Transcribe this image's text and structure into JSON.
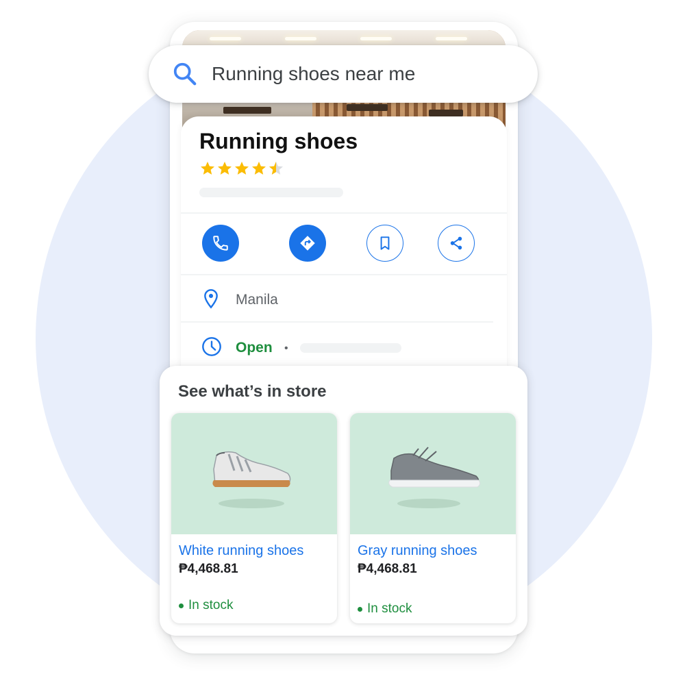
{
  "search": {
    "query": "Running shoes near me"
  },
  "place": {
    "title": "Running shoes",
    "rating": 4.5,
    "rating_max": 5,
    "location": "Manila",
    "status": "Open",
    "status_separator": "•"
  },
  "actions": [
    {
      "name": "call",
      "icon": "phone-icon"
    },
    {
      "name": "directions",
      "icon": "directions-icon"
    },
    {
      "name": "save",
      "icon": "bookmark-icon"
    },
    {
      "name": "share",
      "icon": "share-icon"
    }
  ],
  "store": {
    "title": "See what’s in store",
    "products": [
      {
        "name": "White running shoes",
        "price": "₱4,468.81",
        "stock": "In stock"
      },
      {
        "name": "Gray running shoes",
        "price": "₱4,468.81",
        "stock": "In stock"
      }
    ]
  },
  "colors": {
    "accent": "#1a73e8",
    "open_green": "#1e8e3e",
    "star_yellow": "#fbbc04",
    "product_bg": "#ceeadb",
    "backdrop": "#e8eefb"
  }
}
